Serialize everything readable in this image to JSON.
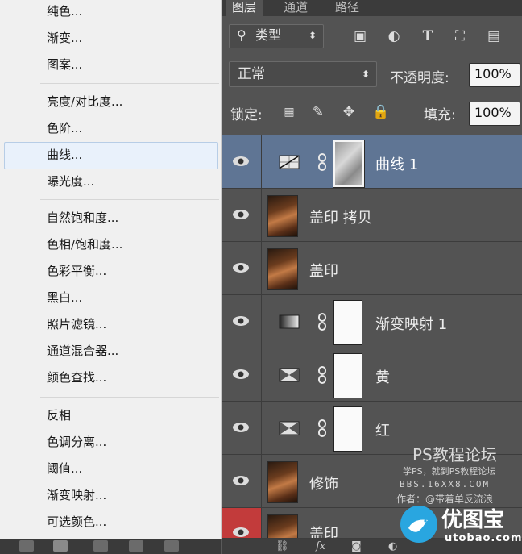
{
  "menu": {
    "items": [
      {
        "label": "纯色..."
      },
      {
        "label": "渐变..."
      },
      {
        "label": "图案..."
      },
      {
        "label": "亮度/对比度..."
      },
      {
        "label": "色阶..."
      },
      {
        "label": "曲线..."
      },
      {
        "label": "曝光度..."
      },
      {
        "label": "自然饱和度..."
      },
      {
        "label": "色相/饱和度..."
      },
      {
        "label": "色彩平衡..."
      },
      {
        "label": "黑白..."
      },
      {
        "label": "照片滤镜..."
      },
      {
        "label": "通道混合器..."
      },
      {
        "label": "颜色查找..."
      },
      {
        "label": "反相"
      },
      {
        "label": "色调分离..."
      },
      {
        "label": "阈值..."
      },
      {
        "label": "渐变映射..."
      },
      {
        "label": "可选颜色..."
      }
    ],
    "highlighted": "曲线..."
  },
  "panel": {
    "tabs": [
      "图层",
      "通道",
      "路径"
    ],
    "filter": {
      "kind": "类型"
    },
    "blend_mode": "正常",
    "opacity_label": "不透明度:",
    "opacity_value": "100%",
    "lock_label": "锁定:",
    "fill_label": "填充:",
    "fill_value": "100%",
    "layers": [
      {
        "name": "曲线 1",
        "kind": "curves",
        "selected": true
      },
      {
        "name": "盖印 拷贝",
        "kind": "photo"
      },
      {
        "name": "盖印",
        "kind": "photo"
      },
      {
        "name": "渐变映射 1",
        "kind": "gradient"
      },
      {
        "name": "黄",
        "kind": "channel"
      },
      {
        "name": "红",
        "kind": "channel"
      },
      {
        "name": "修饰",
        "kind": "photo"
      },
      {
        "name": "盖印",
        "kind": "photo"
      }
    ],
    "bottom_icons": [
      "link-icon",
      "fx-icon",
      "mask-icon",
      "adjustment-icon"
    ]
  },
  "watermark": {
    "title": "PS教程论坛",
    "line1": "学PS，就到PS教程论坛",
    "line2": "BBS.16XX8.COM",
    "line3": "作者：@带着单反流浪",
    "brand": "优图宝",
    "site": "utobao.com"
  },
  "colors": {
    "selection": "#5f7594",
    "menu_highlight": "#e9f1fb",
    "logo": "#29a6e0"
  }
}
